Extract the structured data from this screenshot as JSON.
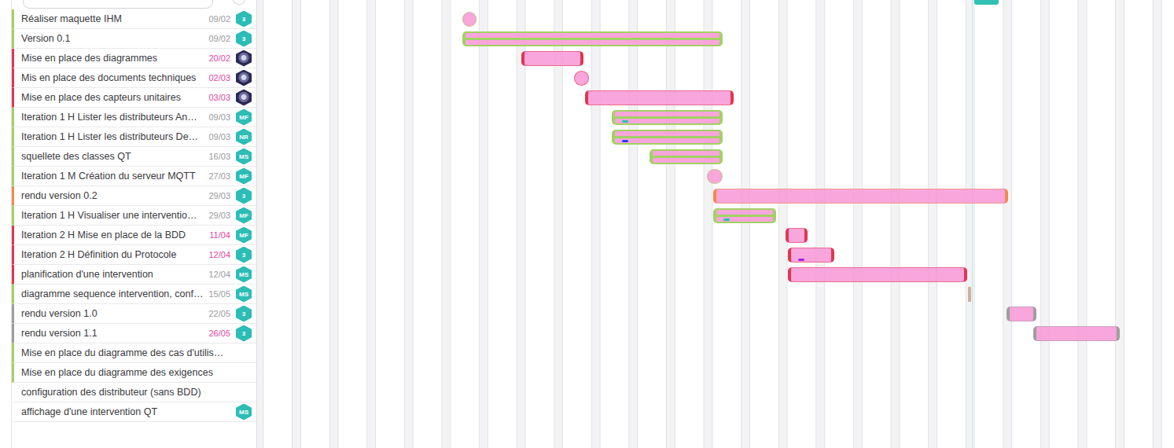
{
  "timeline": {
    "today": 133.7
  },
  "tasks": [
    {
      "name": "Réaliser maquette IHM",
      "date": "09/02",
      "date_late": false,
      "status_color": "#a2d164",
      "assignee": {
        "kind": "initials",
        "label": "3"
      },
      "bar": {
        "kind": "point",
        "start": 38.4,
        "days": 2.7,
        "color": "#a2d164",
        "done": true,
        "marker_color": null
      }
    },
    {
      "name": "Version 0.1",
      "date": "09/02",
      "date_late": false,
      "status_color": "#a2d164",
      "assignee": {
        "kind": "initials",
        "label": "3"
      },
      "bar": {
        "kind": "range",
        "start": 38.4,
        "days": 48.7,
        "color": "#a2d164",
        "done": true,
        "marker_color": null
      }
    },
    {
      "name": "Mise en place des diagrammes",
      "date": "20/02",
      "date_late": true,
      "status_color": "#e0364f",
      "assignee": {
        "kind": "photo",
        "label": ""
      },
      "bar": {
        "kind": "range",
        "start": 49.4,
        "days": 11.6,
        "color": "#e0364f",
        "done": false,
        "marker_color": null
      }
    },
    {
      "name": "Mis en place des documents techniques",
      "date": "02/03",
      "date_late": true,
      "status_color": "#e0364f",
      "assignee": {
        "kind": "photo",
        "label": ""
      },
      "bar": {
        "kind": "point",
        "start": 59.3,
        "days": 2.7,
        "color": "#e0364f",
        "done": false,
        "marker_color": null
      }
    },
    {
      "name": "Mise en place des capteurs unitaires",
      "date": "03/03",
      "date_late": true,
      "status_color": "#e0364f",
      "assignee": {
        "kind": "photo",
        "label": ""
      },
      "bar": {
        "kind": "range",
        "start": 61.3,
        "days": 27.8,
        "color": "#e0364f",
        "done": false,
        "marker_color": null
      }
    },
    {
      "name": "Iteration 1 H Lister les distributeurs An…",
      "date": "09/03",
      "date_late": false,
      "status_color": "#a2d164",
      "assignee": {
        "kind": "initials",
        "label": "MF"
      },
      "bar": {
        "kind": "range",
        "start": 66.3,
        "days": 20.8,
        "color": "#a2d164",
        "done": true,
        "marker_color": "#25c4b0"
      }
    },
    {
      "name": "Iteration 1 H Lister les distributeurs De…",
      "date": "09/03",
      "date_late": false,
      "status_color": "#a2d164",
      "assignee": {
        "kind": "initials",
        "label": "NR"
      },
      "bar": {
        "kind": "range",
        "start": 66.3,
        "days": 20.8,
        "color": "#a2d164",
        "done": true,
        "marker_color": "#2a3cf0"
      }
    },
    {
      "name": "squellete des classes QT",
      "date": "16/03",
      "date_late": false,
      "status_color": "#a2d164",
      "assignee": {
        "kind": "initials",
        "label": "MS"
      },
      "bar": {
        "kind": "range",
        "start": 73.4,
        "days": 13.7,
        "color": "#a2d164",
        "done": true,
        "marker_color": null
      }
    },
    {
      "name": "Iteration 1 M Création du serveur MQTT",
      "date": "27/03",
      "date_late": false,
      "status_color": "#a2d164",
      "assignee": {
        "kind": "initials",
        "label": "MF"
      },
      "bar": {
        "kind": "point",
        "start": 84.1,
        "days": 2.9,
        "color": "#a2d164",
        "done": true,
        "marker_color": null
      }
    },
    {
      "name": "rendu version 0.2",
      "date": "29/03",
      "date_late": false,
      "status_color": "#f08a4b",
      "assignee": {
        "kind": "initials",
        "label": "3"
      },
      "bar": {
        "kind": "range",
        "start": 85.3,
        "days": 55.1,
        "color": "#f08a4b",
        "done": false,
        "marker_color": null
      }
    },
    {
      "name": "Iteration 1 H Visualiser une interventio…",
      "date": "29/03",
      "date_late": false,
      "status_color": "#a2d164",
      "assignee": {
        "kind": "initials",
        "label": "MF"
      },
      "bar": {
        "kind": "range",
        "start": 85.3,
        "days": 11.8,
        "color": "#a2d164",
        "done": true,
        "marker_color": "#25c4b0"
      }
    },
    {
      "name": "Iteration 2 H Mise en place de la BDD",
      "date": "11/04",
      "date_late": true,
      "status_color": "#e0364f",
      "assignee": {
        "kind": "initials",
        "label": "MF"
      },
      "bar": {
        "kind": "range",
        "start": 98.8,
        "days": 4.1,
        "color": "#e0364f",
        "done": false,
        "marker_color": null
      }
    },
    {
      "name": "Iteration 2 H Définition du Protocole",
      "date": "12/04",
      "date_late": true,
      "status_color": "#e0364f",
      "assignee": {
        "kind": "initials",
        "label": "3"
      },
      "bar": {
        "kind": "range",
        "start": 99.3,
        "days": 8.7,
        "color": "#e0364f",
        "done": false,
        "marker_color": "#a020f0"
      }
    },
    {
      "name": "planification d'une intervention",
      "date": "12/04",
      "date_late": false,
      "status_color": "#e0364f",
      "assignee": {
        "kind": "initials",
        "label": "MS"
      },
      "bar": {
        "kind": "range",
        "start": 99.3,
        "days": 33.5,
        "color": "#e0364f",
        "done": false,
        "marker_color": null
      }
    },
    {
      "name": "diagramme sequence intervention, conf…",
      "date": "15/05",
      "date_late": false,
      "status_color": "#a2d164",
      "assignee": {
        "kind": "initials",
        "label": "MS"
      },
      "bar": {
        "kind": "line",
        "start": 132.9,
        "days": 0.6,
        "color": "#c9a48c",
        "done": false,
        "marker_color": null
      }
    },
    {
      "name": "rendu version 1.0",
      "date": "22/05",
      "date_late": false,
      "status_color": "#9e9e9e",
      "assignee": {
        "kind": "initials",
        "label": "3"
      },
      "bar": {
        "kind": "range",
        "start": 140.1,
        "days": 5.6,
        "color": "#9e9e9e",
        "done": false,
        "marker_color": null
      }
    },
    {
      "name": "rendu version 1.1",
      "date": "26/05",
      "date_late": true,
      "status_color": "#9e9e9e",
      "assignee": {
        "kind": "initials",
        "label": "3"
      },
      "bar": {
        "kind": "range",
        "start": 145.1,
        "days": 16.2,
        "color": "#9e9e9e",
        "done": false,
        "marker_color": null
      }
    },
    {
      "name": "Mise en place du diagramme des cas d'utilis…",
      "date": null,
      "date_late": false,
      "status_color": "#a2d164",
      "assignee": null,
      "bar": null
    },
    {
      "name": "Mise en place du diagramme des exigences",
      "date": null,
      "date_late": false,
      "status_color": "#a2d164",
      "assignee": null,
      "bar": null
    },
    {
      "name": "configuration des distributeur (sans BDD)",
      "date": null,
      "date_late": false,
      "status_color": null,
      "assignee": null,
      "bar": null
    },
    {
      "name": "affichage d'une intervention QT",
      "date": null,
      "date_late": false,
      "status_color": null,
      "assignee": {
        "kind": "initials",
        "label": "MS"
      },
      "bar": null
    }
  ]
}
